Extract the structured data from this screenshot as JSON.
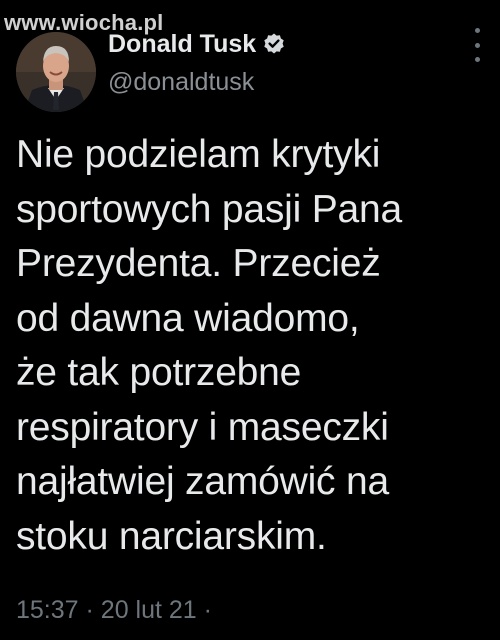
{
  "watermark": "www.wiocha.pl",
  "tweet": {
    "author": {
      "display_name": "Donald Tusk",
      "handle": "@donaldtusk",
      "verified": true
    },
    "text": "Nie podzielam krytyki\nsportowych pasji Pana\nPrezydenta. Przecież\nod dawna wiadomo,\nże tak potrzebne\nrespiratory i maseczki\nnajłatwiej zamówić na\nstoku narciarskim.",
    "time": "15:37",
    "separator": "·",
    "date": "20 lut 21",
    "trailing_separator": "·"
  },
  "icons": {
    "verified": "verified-badge-icon",
    "more": "more-options-icon",
    "avatar": "profile-photo"
  },
  "colors": {
    "background": "#000000",
    "text_primary": "#e7e9ea",
    "text_secondary": "#6e767d"
  }
}
